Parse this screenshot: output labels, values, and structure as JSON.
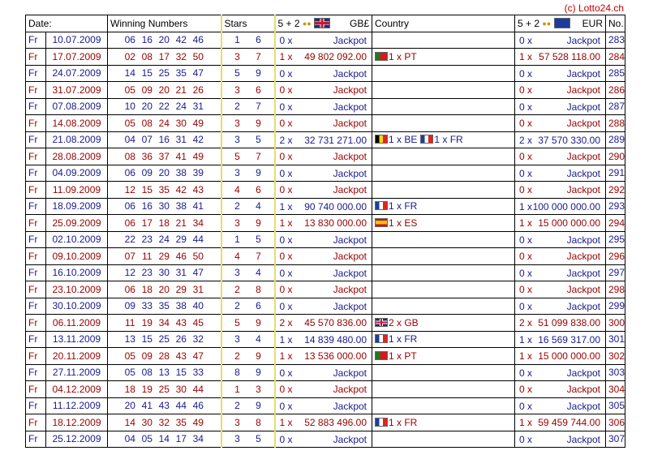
{
  "copyright": "(c) Lotto24.ch",
  "headers": {
    "date": "Date:",
    "numbers": "Winning Numbers",
    "stars": "Stars",
    "prize_gb_prefix": "5 + 2",
    "prize_gb_currency": "GB£",
    "country": "Country",
    "prize_eu_prefix": "5 + 2",
    "prize_eu_currency": "EUR",
    "no": "No."
  },
  "rows": [
    {
      "day": "Fr",
      "date": "10.07.2009",
      "nums": [
        "06",
        "16",
        "20",
        "42",
        "46"
      ],
      "stars": [
        "1",
        "6"
      ],
      "gb_count": "0 x",
      "gb_amount": "Jackpot",
      "countries": [],
      "eu_count": "0 x",
      "eu_amount": "Jackpot",
      "no": "283"
    },
    {
      "day": "Fr",
      "date": "17.07.2009",
      "nums": [
        "02",
        "08",
        "17",
        "32",
        "50"
      ],
      "stars": [
        "3",
        "7"
      ],
      "gb_count": "1 x",
      "gb_amount": "49 802 092.00",
      "countries": [
        {
          "flag": "PT",
          "label": "1 x PT"
        }
      ],
      "eu_count": "1 x",
      "eu_amount": "57 528 118.00",
      "no": "284"
    },
    {
      "day": "Fr",
      "date": "24.07.2009",
      "nums": [
        "14",
        "15",
        "25",
        "35",
        "47"
      ],
      "stars": [
        "5",
        "9"
      ],
      "gb_count": "0 x",
      "gb_amount": "Jackpot",
      "countries": [],
      "eu_count": "0 x",
      "eu_amount": "Jackpot",
      "no": "285"
    },
    {
      "day": "Fr",
      "date": "31.07.2009",
      "nums": [
        "05",
        "09",
        "20",
        "21",
        "26"
      ],
      "stars": [
        "3",
        "6"
      ],
      "gb_count": "0 x",
      "gb_amount": "Jackpot",
      "countries": [],
      "eu_count": "0 x",
      "eu_amount": "Jackpot",
      "no": "286"
    },
    {
      "day": "Fr",
      "date": "07.08.2009",
      "nums": [
        "10",
        "20",
        "22",
        "24",
        "31"
      ],
      "stars": [
        "2",
        "7"
      ],
      "gb_count": "0 x",
      "gb_amount": "Jackpot",
      "countries": [],
      "eu_count": "0 x",
      "eu_amount": "Jackpot",
      "no": "287"
    },
    {
      "day": "Fr",
      "date": "14.08.2009",
      "nums": [
        "05",
        "08",
        "24",
        "30",
        "49"
      ],
      "stars": [
        "3",
        "9"
      ],
      "gb_count": "0 x",
      "gb_amount": "Jackpot",
      "countries": [],
      "eu_count": "0 x",
      "eu_amount": "Jackpot",
      "no": "288"
    },
    {
      "day": "Fr",
      "date": "21.08.2009",
      "nums": [
        "04",
        "07",
        "16",
        "31",
        "42"
      ],
      "stars": [
        "3",
        "5"
      ],
      "gb_count": "2 x",
      "gb_amount": "32 731 271.00",
      "countries": [
        {
          "flag": "BE",
          "label": "1 x BE"
        },
        {
          "flag": "FR",
          "label": "1 x FR"
        }
      ],
      "eu_count": "2 x",
      "eu_amount": "37 570 330.00",
      "no": "289"
    },
    {
      "day": "Fr",
      "date": "28.08.2009",
      "nums": [
        "08",
        "36",
        "37",
        "41",
        "49"
      ],
      "stars": [
        "5",
        "7"
      ],
      "gb_count": "0 x",
      "gb_amount": "Jackpot",
      "countries": [],
      "eu_count": "0 x",
      "eu_amount": "Jackpot",
      "no": "290"
    },
    {
      "day": "Fr",
      "date": "04.09.2009",
      "nums": [
        "06",
        "09",
        "20",
        "38",
        "39"
      ],
      "stars": [
        "3",
        "9"
      ],
      "gb_count": "0 x",
      "gb_amount": "Jackpot",
      "countries": [],
      "eu_count": "0 x",
      "eu_amount": "Jackpot",
      "no": "291"
    },
    {
      "day": "Fr",
      "date": "11.09.2009",
      "nums": [
        "12",
        "15",
        "35",
        "42",
        "43"
      ],
      "stars": [
        "4",
        "6"
      ],
      "gb_count": "0 x",
      "gb_amount": "Jackpot",
      "countries": [],
      "eu_count": "0 x",
      "eu_amount": "Jackpot",
      "no": "292"
    },
    {
      "day": "Fr",
      "date": "18.09.2009",
      "nums": [
        "06",
        "16",
        "30",
        "38",
        "41"
      ],
      "stars": [
        "2",
        "4"
      ],
      "gb_count": "1 x",
      "gb_amount": "90 740 000.00",
      "countries": [
        {
          "flag": "FR",
          "label": "1 x FR"
        }
      ],
      "eu_count": "1 x",
      "eu_amount": "100 000 000.00",
      "no": "293"
    },
    {
      "day": "Fr",
      "date": "25.09.2009",
      "nums": [
        "06",
        "17",
        "18",
        "21",
        "34"
      ],
      "stars": [
        "3",
        "9"
      ],
      "gb_count": "1 x",
      "gb_amount": "13 830 000.00",
      "countries": [
        {
          "flag": "ES",
          "label": "1 x ES"
        }
      ],
      "eu_count": "1 x",
      "eu_amount": "15 000 000.00",
      "no": "294"
    },
    {
      "day": "Fr",
      "date": "02.10.2009",
      "nums": [
        "22",
        "23",
        "24",
        "29",
        "44"
      ],
      "stars": [
        "1",
        "5"
      ],
      "gb_count": "0 x",
      "gb_amount": "Jackpot",
      "countries": [],
      "eu_count": "0 x",
      "eu_amount": "Jackpot",
      "no": "295"
    },
    {
      "day": "Fr",
      "date": "09.10.2009",
      "nums": [
        "07",
        "11",
        "29",
        "46",
        "50"
      ],
      "stars": [
        "4",
        "7"
      ],
      "gb_count": "0 x",
      "gb_amount": "Jackpot",
      "countries": [],
      "eu_count": "0 x",
      "eu_amount": "Jackpot",
      "no": "296"
    },
    {
      "day": "Fr",
      "date": "16.10.2009",
      "nums": [
        "12",
        "23",
        "30",
        "31",
        "47"
      ],
      "stars": [
        "3",
        "4"
      ],
      "gb_count": "0 x",
      "gb_amount": "Jackpot",
      "countries": [],
      "eu_count": "0 x",
      "eu_amount": "Jackpot",
      "no": "297"
    },
    {
      "day": "Fr",
      "date": "23.10.2009",
      "nums": [
        "06",
        "18",
        "20",
        "29",
        "31"
      ],
      "stars": [
        "2",
        "8"
      ],
      "gb_count": "0 x",
      "gb_amount": "Jackpot",
      "countries": [],
      "eu_count": "0 x",
      "eu_amount": "Jackpot",
      "no": "298"
    },
    {
      "day": "Fr",
      "date": "30.10.2009",
      "nums": [
        "09",
        "33",
        "35",
        "38",
        "40"
      ],
      "stars": [
        "2",
        "6"
      ],
      "gb_count": "0 x",
      "gb_amount": "Jackpot",
      "countries": [],
      "eu_count": "0 x",
      "eu_amount": "Jackpot",
      "no": "299"
    },
    {
      "day": "Fr",
      "date": "06.11.2009",
      "nums": [
        "11",
        "19",
        "34",
        "43",
        "45"
      ],
      "stars": [
        "5",
        "9"
      ],
      "gb_count": "2 x",
      "gb_amount": "45 570 836.00",
      "countries": [
        {
          "flag": "GB",
          "label": "2 x GB"
        }
      ],
      "eu_count": "2 x",
      "eu_amount": "51 099 838.00",
      "no": "300"
    },
    {
      "day": "Fr",
      "date": "13.11.2009",
      "nums": [
        "13",
        "15",
        "25",
        "26",
        "32"
      ],
      "stars": [
        "3",
        "4"
      ],
      "gb_count": "1 x",
      "gb_amount": "14 839 480.00",
      "countries": [
        {
          "flag": "FR",
          "label": "1 x FR"
        }
      ],
      "eu_count": "1 x",
      "eu_amount": "16 569 317.00",
      "no": "301"
    },
    {
      "day": "Fr",
      "date": "20.11.2009",
      "nums": [
        "05",
        "09",
        "28",
        "43",
        "47"
      ],
      "stars": [
        "2",
        "9"
      ],
      "gb_count": "1 x",
      "gb_amount": "13 536 000.00",
      "countries": [
        {
          "flag": "PT",
          "label": "1 x PT"
        }
      ],
      "eu_count": "1 x",
      "eu_amount": "15 000 000.00",
      "no": "302"
    },
    {
      "day": "Fr",
      "date": "27.11.2009",
      "nums": [
        "05",
        "08",
        "13",
        "15",
        "33"
      ],
      "stars": [
        "8",
        "9"
      ],
      "gb_count": "0 x",
      "gb_amount": "Jackpot",
      "countries": [],
      "eu_count": "0 x",
      "eu_amount": "Jackpot",
      "no": "303"
    },
    {
      "day": "Fr",
      "date": "04.12.2009",
      "nums": [
        "18",
        "19",
        "25",
        "30",
        "44"
      ],
      "stars": [
        "1",
        "3"
      ],
      "gb_count": "0 x",
      "gb_amount": "Jackpot",
      "countries": [],
      "eu_count": "0 x",
      "eu_amount": "Jackpot",
      "no": "304"
    },
    {
      "day": "Fr",
      "date": "11.12.2009",
      "nums": [
        "20",
        "41",
        "43",
        "44",
        "46"
      ],
      "stars": [
        "2",
        "9"
      ],
      "gb_count": "0 x",
      "gb_amount": "Jackpot",
      "countries": [],
      "eu_count": "0 x",
      "eu_amount": "Jackpot",
      "no": "305"
    },
    {
      "day": "Fr",
      "date": "18.12.2009",
      "nums": [
        "14",
        "30",
        "32",
        "35",
        "49"
      ],
      "stars": [
        "3",
        "8"
      ],
      "gb_count": "1 x",
      "gb_amount": "52 883 496.00",
      "countries": [
        {
          "flag": "FR",
          "label": "1 x FR"
        }
      ],
      "eu_count": "1 x",
      "eu_amount": "59 459 744.00",
      "no": "306"
    },
    {
      "day": "Fr",
      "date": "25.12.2009",
      "nums": [
        "04",
        "05",
        "14",
        "17",
        "34"
      ],
      "stars": [
        "3",
        "5"
      ],
      "gb_count": "0 x",
      "gb_amount": "Jackpot",
      "countries": [],
      "eu_count": "0 x",
      "eu_amount": "Jackpot",
      "no": "307"
    }
  ]
}
